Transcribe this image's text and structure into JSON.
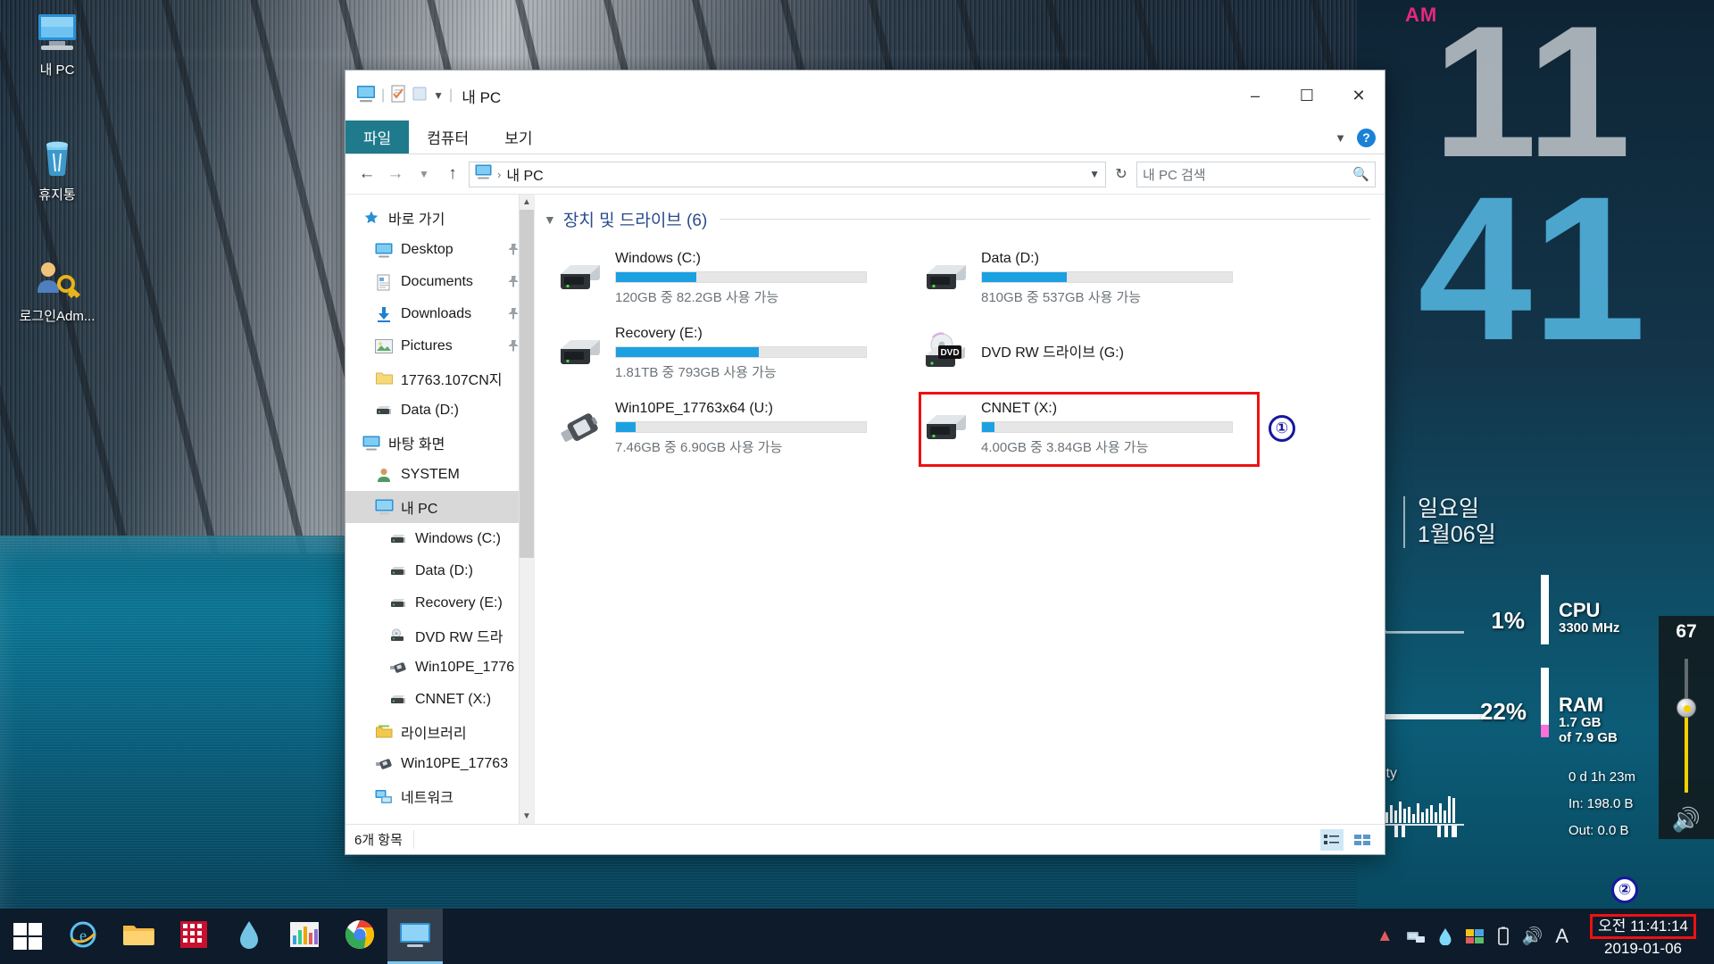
{
  "desktop": {
    "icons": [
      {
        "name": "내 PC",
        "icon": "computer-icon"
      },
      {
        "name": "휴지통",
        "icon": "recycle-bin-icon"
      },
      {
        "name": "로그인Adm...",
        "icon": "key-user-icon"
      }
    ],
    "clock_widget": {
      "meridiem": "AM",
      "hours": "11",
      "minutes": "41",
      "weekday": "일요일",
      "date": "1월06일"
    },
    "system_monitor": {
      "cpu_percent": "1%",
      "cpu_label": "CPU",
      "cpu_speed": "3300 MHz",
      "ram_percent": "22%",
      "ram_label": "RAM",
      "ram_used": "1.7 GB",
      "ram_total": "of 7.9 GB",
      "network_label": "Network Activity",
      "uptime": "0 d 1h 23m",
      "net_in": "In: 198.0 B",
      "net_out": "Out: 0.0 B"
    },
    "volume_gadget": {
      "value": "67",
      "icon": "speaker-icon"
    }
  },
  "explorer": {
    "title": "내 PC",
    "quick_access": {
      "computer_icon": "computer-icon",
      "properties_icon": "properties-icon",
      "newfolder_icon": "new-folder-icon",
      "dropdown_icon": "chevron-down-icon"
    },
    "caption": {
      "minimize": "–",
      "maximize": "☐",
      "close": "✕"
    },
    "ribbon_tabs": [
      {
        "label": "파일",
        "active": true
      },
      {
        "label": "컴퓨터",
        "active": false
      },
      {
        "label": "보기",
        "active": false
      }
    ],
    "ribbon_right": {
      "collapse_icon": "chevron-down-icon",
      "help_label": "?"
    },
    "address": {
      "back_icon": "arrow-left-icon",
      "forward_icon": "arrow-right-icon",
      "recent_icon": "chevron-down-icon",
      "up_icon": "arrow-up-icon",
      "path_icon": "computer-icon",
      "separator": "›",
      "crumb": "내 PC",
      "dropdown_icon": "chevron-down-icon",
      "refresh_icon": "refresh-icon"
    },
    "search": {
      "placeholder": "내 PC 검색",
      "icon": "search-icon"
    },
    "nav_items": [
      {
        "label": "바로 가기",
        "icon": "star-icon",
        "level": "root",
        "pinned": false,
        "selected": false
      },
      {
        "label": "Desktop",
        "icon": "desktop-icon",
        "level": "l1",
        "pinned": true,
        "selected": false
      },
      {
        "label": "Documents",
        "icon": "documents-icon",
        "level": "l1",
        "pinned": true,
        "selected": false
      },
      {
        "label": "Downloads",
        "icon": "downloads-icon",
        "level": "l1",
        "pinned": true,
        "selected": false
      },
      {
        "label": "Pictures",
        "icon": "pictures-icon",
        "level": "l1",
        "pinned": true,
        "selected": false
      },
      {
        "label": "17763.107CN지",
        "icon": "folder-icon",
        "level": "l1",
        "pinned": false,
        "selected": false
      },
      {
        "label": "Data (D:)",
        "icon": "drive-icon",
        "level": "l1",
        "pinned": false,
        "selected": false
      },
      {
        "label": "바탕 화면",
        "icon": "desktop-icon",
        "level": "root",
        "pinned": false,
        "selected": false
      },
      {
        "label": "SYSTEM",
        "icon": "user-icon",
        "level": "l1",
        "pinned": false,
        "selected": false
      },
      {
        "label": "내 PC",
        "icon": "computer-icon",
        "level": "l1",
        "pinned": false,
        "selected": true
      },
      {
        "label": "Windows (C:)",
        "icon": "drive-icon",
        "level": "l2",
        "pinned": false,
        "selected": false
      },
      {
        "label": "Data (D:)",
        "icon": "drive-icon",
        "level": "l2",
        "pinned": false,
        "selected": false
      },
      {
        "label": "Recovery (E:)",
        "icon": "drive-icon",
        "level": "l2",
        "pinned": false,
        "selected": false
      },
      {
        "label": "DVD RW 드라",
        "icon": "dvd-icon",
        "level": "l2",
        "pinned": false,
        "selected": false
      },
      {
        "label": "Win10PE_1776",
        "icon": "usb-icon",
        "level": "l2",
        "pinned": false,
        "selected": false
      },
      {
        "label": "CNNET (X:)",
        "icon": "drive-icon",
        "level": "l2",
        "pinned": false,
        "selected": false
      },
      {
        "label": "라이브러리",
        "icon": "library-icon",
        "level": "l1",
        "pinned": false,
        "selected": false
      },
      {
        "label": "Win10PE_17763",
        "icon": "usb-icon",
        "level": "l1",
        "pinned": false,
        "selected": false
      },
      {
        "label": "네트워크",
        "icon": "network-icon",
        "level": "l1",
        "pinned": false,
        "selected": false
      }
    ],
    "group": {
      "title": "장치 및 드라이브 (6)",
      "chevron": "chevron-down-icon"
    },
    "drives": [
      {
        "name": "Windows (C:)",
        "free_text": "120GB 중 82.2GB 사용 가능",
        "used_percent": 32,
        "bar": true,
        "icon": "hdd-icon",
        "highlight": false
      },
      {
        "name": "Data (D:)",
        "free_text": "810GB 중 537GB 사용 가능",
        "used_percent": 34,
        "bar": true,
        "icon": "hdd-icon",
        "highlight": false
      },
      {
        "name": "Recovery (E:)",
        "free_text": "1.81TB 중 793GB 사용 가능",
        "used_percent": 57,
        "bar": true,
        "icon": "hdd-icon",
        "highlight": false
      },
      {
        "name": "DVD RW 드라이브 (G:)",
        "free_text": "",
        "used_percent": 0,
        "bar": false,
        "icon": "dvd-icon",
        "highlight": false
      },
      {
        "name": "Win10PE_17763x64 (U:)",
        "free_text": "7.46GB 중 6.90GB 사용 가능",
        "used_percent": 8,
        "bar": true,
        "icon": "usb-icon",
        "highlight": false
      },
      {
        "name": "CNNET (X:)",
        "free_text": "4.00GB 중 3.84GB 사용 가능",
        "used_percent": 5,
        "bar": true,
        "icon": "hdd-icon",
        "highlight": true
      }
    ],
    "status": {
      "count": "6개 항목",
      "view_tiles_icon": "tiles-view-icon",
      "view_details_icon": "details-view-icon"
    }
  },
  "annotations": [
    {
      "id": "1",
      "label": "①"
    },
    {
      "id": "2",
      "label": "②"
    }
  ],
  "taskbar": {
    "start_icon": "windows-start-icon",
    "items": [
      {
        "icon": "internet-explorer-icon",
        "name": "internet-explorer",
        "active": false
      },
      {
        "icon": "file-explorer-icon",
        "name": "file-explorer-pinned",
        "active": false
      },
      {
        "icon": "red-app-icon",
        "name": "red-grid-app",
        "active": false
      },
      {
        "icon": "water-drop-icon",
        "name": "water-drop-app",
        "active": false
      },
      {
        "icon": "chart-app-icon",
        "name": "chart-app",
        "active": false
      },
      {
        "icon": "chrome-icon",
        "name": "google-chrome",
        "active": false
      },
      {
        "icon": "explorer-window-icon",
        "name": "explorer-window",
        "active": true
      }
    ],
    "tray": [
      {
        "icon": "caret-up-icon",
        "name": "show-hidden-icons"
      },
      {
        "icon": "network-tray-icon",
        "name": "network-status"
      },
      {
        "icon": "water-drop-tray-icon",
        "name": "drop-tray"
      },
      {
        "icon": "color-tray-icon",
        "name": "color-tray"
      },
      {
        "icon": "battery-icon",
        "name": "battery-status"
      },
      {
        "icon": "volume-icon",
        "name": "volume-status"
      },
      {
        "icon": "ime-icon",
        "name": "input-method"
      }
    ],
    "clock": {
      "time": "오전 11:41:14",
      "date": "2019-01-06"
    }
  },
  "colors": {
    "accent_blue": "#1ba1e2",
    "file_tab": "#1f7a8c",
    "annotation_red": "#ee1111",
    "annotation_navy": "#16179e",
    "group_title": "#2a4b8d",
    "selection_gray": "#d8d8d8"
  }
}
